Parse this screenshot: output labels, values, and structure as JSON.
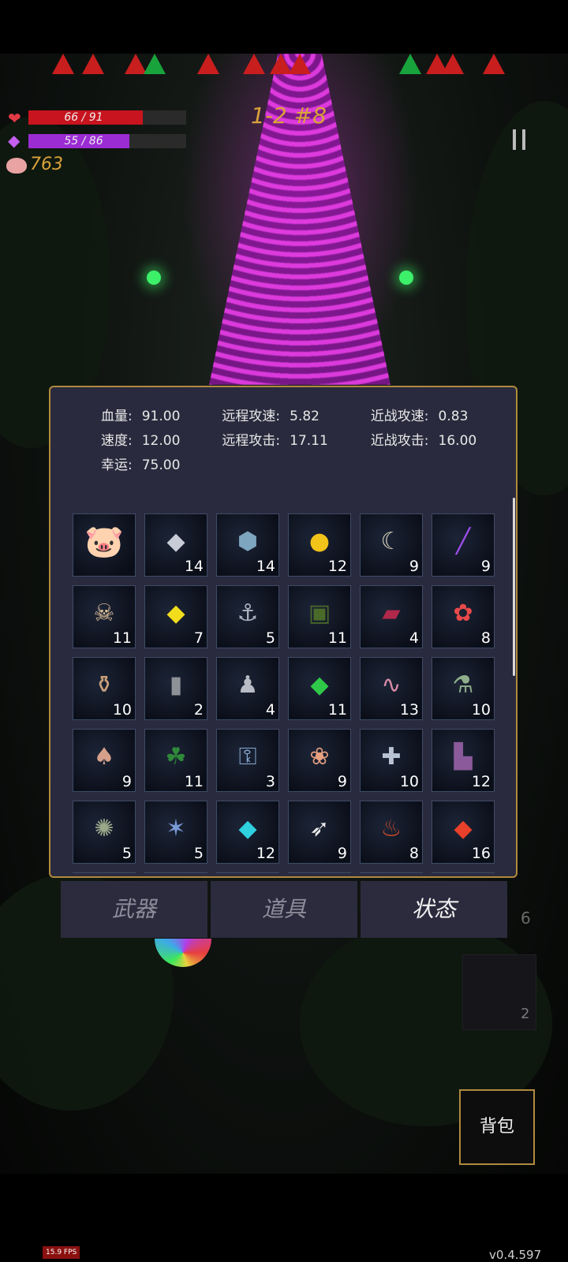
{
  "hud": {
    "hp_text": "66 / 91",
    "hp_fraction": 0.725,
    "mp_text": "55 / 86",
    "mp_fraction": 0.64,
    "gold": "763",
    "stage": "1-2 #8",
    "hp_color": "#c8141e",
    "mp_color": "#9b2cd4"
  },
  "stats": [
    [
      {
        "label": "血量:",
        "value": "91.00"
      },
      {
        "label": "远程攻速:",
        "value": "5.82"
      },
      {
        "label": "近战攻速:",
        "value": "0.83"
      }
    ],
    [
      {
        "label": "速度:",
        "value": "12.00"
      },
      {
        "label": "远程攻击:",
        "value": "17.11"
      },
      {
        "label": "近战攻击:",
        "value": "16.00"
      }
    ],
    [
      {
        "label": "幸运:",
        "value": "75.00"
      }
    ]
  ],
  "items": [
    {
      "icon": "piggy-bank-icon",
      "glyph": "🐷",
      "count": ""
    },
    {
      "icon": "silver-ore-icon",
      "glyph": "◆",
      "color": "#c8ccd6",
      "count": "14"
    },
    {
      "icon": "blue-stone-icon",
      "glyph": "⬢",
      "color": "#7fa6bf",
      "count": "14"
    },
    {
      "icon": "gold-coin-icon",
      "glyph": "●",
      "color": "#f2c318",
      "count": "12"
    },
    {
      "icon": "horn-icon",
      "glyph": "☾",
      "color": "#d9d0b8",
      "count": "9"
    },
    {
      "icon": "purple-vial-icon",
      "glyph": "╱",
      "color": "#9a4de8",
      "count": "9"
    },
    {
      "icon": "feathered-skull-icon",
      "glyph": "☠",
      "color": "#e8c9a0",
      "count": "11"
    },
    {
      "icon": "yellow-crystal-icon",
      "glyph": "◆",
      "color": "#f2dd1c",
      "count": "7"
    },
    {
      "icon": "anchor-icon",
      "glyph": "⚓",
      "color": "#aab1bd",
      "count": "5"
    },
    {
      "icon": "skull-book-icon",
      "glyph": "▣",
      "color": "#4a6a2a",
      "count": "11"
    },
    {
      "icon": "red-book-icon",
      "glyph": "▰",
      "color": "#b0284a",
      "count": "4"
    },
    {
      "icon": "red-flower-icon",
      "glyph": "✿",
      "color": "#e84a4a",
      "count": "8"
    },
    {
      "icon": "clay-jar-icon",
      "glyph": "⚱",
      "color": "#c9a07a",
      "count": "10"
    },
    {
      "icon": "gravestone-icon",
      "glyph": "▮",
      "color": "#8e9296",
      "count": "2"
    },
    {
      "icon": "hooded-figure-icon",
      "glyph": "♟",
      "color": "#b8bcc4",
      "count": "4"
    },
    {
      "icon": "green-crystal-icon",
      "glyph": "◆",
      "color": "#2fc94a",
      "count": "11"
    },
    {
      "icon": "worm-icon",
      "glyph": "∿",
      "color": "#d88aa6",
      "count": "13"
    },
    {
      "icon": "potion-flask-icon",
      "glyph": "⚗",
      "color": "#8fae8a",
      "count": "10"
    },
    {
      "icon": "mushroom-icon",
      "glyph": "♠",
      "color": "#d6a08a",
      "count": "9"
    },
    {
      "icon": "four-leaf-clover-icon",
      "glyph": "☘",
      "color": "#2f8a3a",
      "count": "11"
    },
    {
      "icon": "key-icon",
      "glyph": "⚿",
      "color": "#8aaed6",
      "count": "3"
    },
    {
      "icon": "flower-garland-icon",
      "glyph": "❀",
      "color": "#e8a080",
      "count": "9"
    },
    {
      "icon": "medkit-icon",
      "glyph": "✚",
      "color": "#b8c4d4",
      "count": "10"
    },
    {
      "icon": "purple-boots-icon",
      "glyph": "▙",
      "color": "#8a5a9a",
      "count": "12"
    },
    {
      "icon": "octopus-icon",
      "glyph": "✺",
      "color": "#9aa88a",
      "count": "5"
    },
    {
      "icon": "dragonfly-icon",
      "glyph": "✶",
      "color": "#7a9ad6",
      "count": "5"
    },
    {
      "icon": "cyan-crystal-icon",
      "glyph": "◆",
      "color": "#2fd0e0",
      "count": "12"
    },
    {
      "icon": "feather-icon",
      "glyph": "➶",
      "color": "#e8e8e8",
      "count": "9"
    },
    {
      "icon": "burning-jar-icon",
      "glyph": "♨",
      "color": "#c84a2a",
      "count": "8"
    },
    {
      "icon": "red-crystal-icon",
      "glyph": "◆",
      "color": "#e8402a",
      "count": "16"
    }
  ],
  "tabs": [
    {
      "label": "武器",
      "active": false
    },
    {
      "label": "道具",
      "active": false
    },
    {
      "label": "状态",
      "active": true
    }
  ],
  "side_counter": "6",
  "npc_counter": "2",
  "bag_label": "背包",
  "fps": "15.9 FPS",
  "version": "v0.4.597"
}
